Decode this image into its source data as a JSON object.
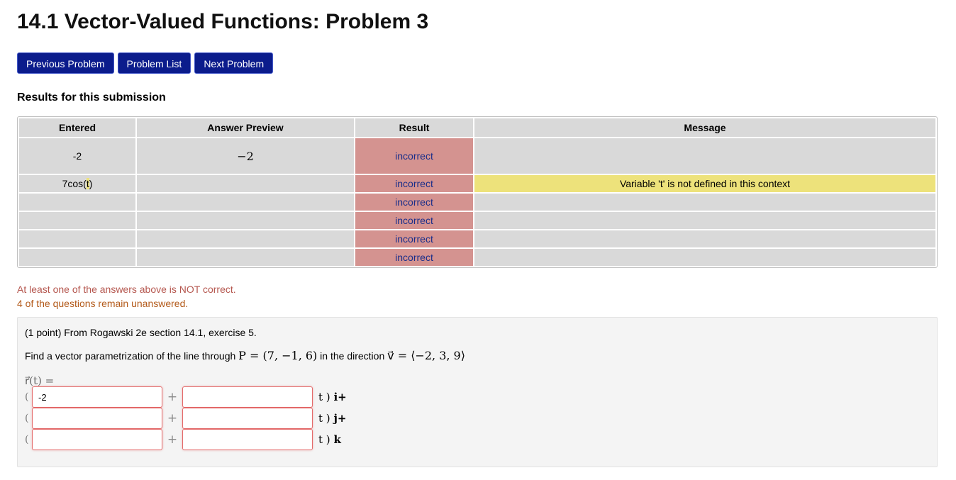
{
  "page": {
    "title": "14.1 Vector-Valued Functions: Problem 3"
  },
  "nav": {
    "previous": "Previous Problem",
    "list": "Problem List",
    "next": "Next Problem"
  },
  "results": {
    "title": "Results for this submission",
    "headers": [
      "Entered",
      "Answer Preview",
      "Result",
      "Message"
    ],
    "rows": [
      {
        "entered": "-2",
        "preview": "−2",
        "result": "incorrect",
        "message": ""
      },
      {
        "entered_pre": "7cos(",
        "entered_hl": "t",
        "entered_post": ")",
        "preview": "",
        "result": "incorrect",
        "message": "Variable 't' is not defined in this context"
      },
      {
        "entered": "",
        "preview": "",
        "result": "incorrect",
        "message": ""
      },
      {
        "entered": "",
        "preview": "",
        "result": "incorrect",
        "message": ""
      },
      {
        "entered": "",
        "preview": "",
        "result": "incorrect",
        "message": ""
      },
      {
        "entered": "",
        "preview": "",
        "result": "incorrect",
        "message": ""
      }
    ],
    "not_correct": "At least one of the answers above is NOT correct.",
    "unanswered": "4 of the questions remain unanswered."
  },
  "problem": {
    "intro": "(1 point) From Rogawski 2e section 14.1, exercise 5.",
    "find_pre": "Find a vector parametrization of the line through ",
    "point": "P = (7, −1, 6)",
    "find_mid": " in the direction ",
    "direction": "v⃗ = ⟨−2, 3, 9⟩",
    "r_label": "r⃗(t) =",
    "open_paren": "(",
    "plus": "+",
    "rows": [
      {
        "a": "-2",
        "b": "",
        "suffix_t": "t )",
        "unit": "i+"
      },
      {
        "a": "",
        "b": "",
        "suffix_t": "t )",
        "unit": "j+"
      },
      {
        "a": "",
        "b": "",
        "suffix_t": "t )",
        "unit": "k"
      }
    ]
  }
}
